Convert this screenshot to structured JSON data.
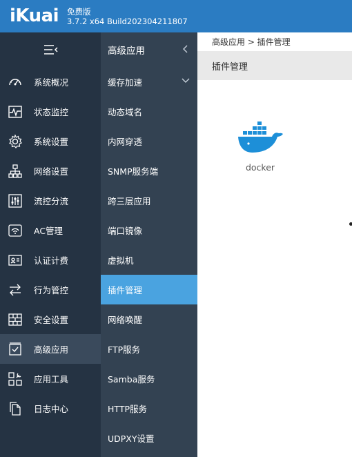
{
  "header": {
    "logo": "iKuai",
    "edition": "免费版",
    "version": "3.7.2 x64 Build202304211807"
  },
  "sidebar": {
    "items": [
      {
        "label": "系统概况",
        "icon": "dashboard-icon"
      },
      {
        "label": "状态监控",
        "icon": "pulse-icon"
      },
      {
        "label": "系统设置",
        "icon": "gear-icon"
      },
      {
        "label": "网络设置",
        "icon": "network-icon"
      },
      {
        "label": "流控分流",
        "icon": "sliders-icon"
      },
      {
        "label": "AC管理",
        "icon": "wifi-ap-icon"
      },
      {
        "label": "认证计费",
        "icon": "id-card-icon"
      },
      {
        "label": "行为管控",
        "icon": "arrows-exchange-icon"
      },
      {
        "label": "安全设置",
        "icon": "firewall-icon"
      },
      {
        "label": "高级应用",
        "icon": "checkbox-icon",
        "active": true
      },
      {
        "label": "应用工具",
        "icon": "tools-grid-icon"
      },
      {
        "label": "日志中心",
        "icon": "document-icon"
      }
    ]
  },
  "subbar": {
    "title": "高级应用",
    "items": [
      {
        "label": "缓存加速",
        "has_chevron": true
      },
      {
        "label": "动态域名"
      },
      {
        "label": "内网穿透"
      },
      {
        "label": "SNMP服务端"
      },
      {
        "label": "跨三层应用"
      },
      {
        "label": "端口镜像"
      },
      {
        "label": "虚拟机"
      },
      {
        "label": "插件管理",
        "active": true
      },
      {
        "label": "网络唤醒"
      },
      {
        "label": "FTP服务"
      },
      {
        "label": "Samba服务"
      },
      {
        "label": "HTTP服务"
      },
      {
        "label": "UDPXY设置"
      }
    ]
  },
  "main": {
    "breadcrumb": "高级应用 > 插件管理",
    "page_title": "插件管理",
    "plugins": [
      {
        "name": "docker",
        "icon": "docker-whale-icon"
      }
    ]
  },
  "colors": {
    "header": "#2b7cc2",
    "sidebar": "#253343",
    "subbar": "#334252",
    "active_sub": "#4aa3e0",
    "docker_blue": "#1d8fd8"
  }
}
